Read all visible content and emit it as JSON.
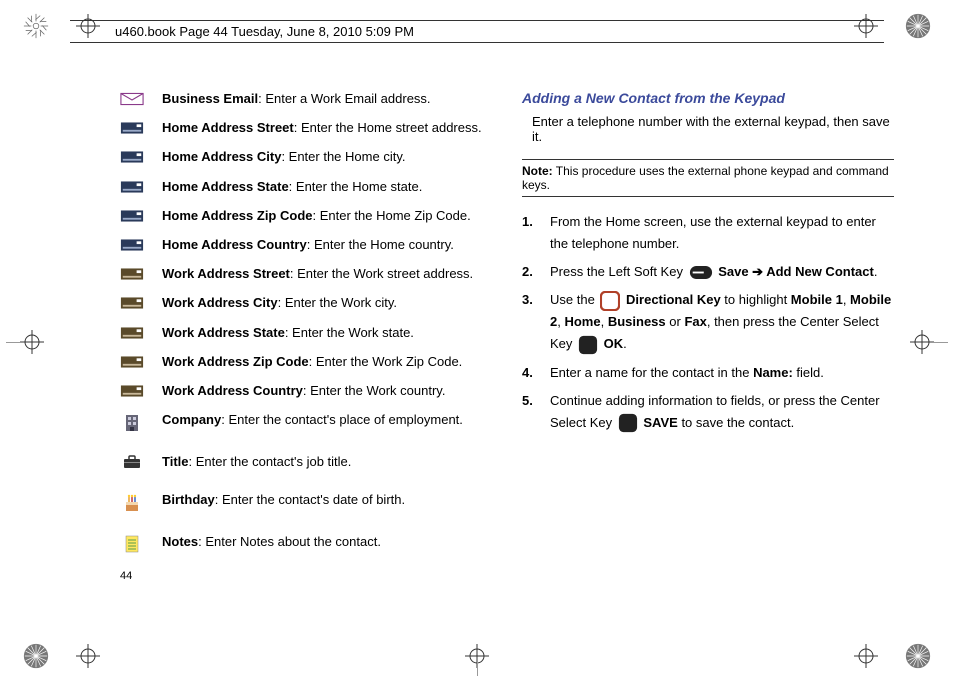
{
  "header": "u460.book  Page 44  Tuesday, June 8, 2010  5:09 PM",
  "page_number": "44",
  "fields": [
    {
      "label": "Business Email",
      "desc": ": Enter a Work Email address.",
      "icon": "envelope"
    },
    {
      "label": "Home Address Street",
      "desc": ": Enter the Home street address.",
      "icon": "card"
    },
    {
      "label": "Home Address City",
      "desc": ": Enter the Home city.",
      "icon": "card"
    },
    {
      "label": "Home Address State",
      "desc": ": Enter the Home state.",
      "icon": "card"
    },
    {
      "label": "Home Address Zip Code",
      "desc": ": Enter the Home Zip Code.",
      "icon": "card"
    },
    {
      "label": "Home Address Country",
      "desc": ": Enter the Home country.",
      "icon": "card"
    },
    {
      "label": "Work Address Street",
      "desc": ": Enter the Work street address.",
      "icon": "card-alt"
    },
    {
      "label": "Work Address City",
      "desc": ": Enter the Work city.",
      "icon": "card-alt"
    },
    {
      "label": "Work Address State",
      "desc": ": Enter the Work state.",
      "icon": "card-alt"
    },
    {
      "label": "Work Address Zip Code",
      "desc": ": Enter the Work Zip Code.",
      "icon": "card-alt"
    },
    {
      "label": "Work Address Country",
      "desc": ": Enter the Work country.",
      "icon": "card-alt"
    },
    {
      "label": "Company",
      "desc": ": Enter the contact's place of employment.",
      "icon": "building"
    },
    {
      "label": "Title",
      "desc": ": Enter the contact's job title.",
      "icon": "briefcase"
    },
    {
      "label": "Birthday",
      "desc": ": Enter the contact's date of birth.",
      "icon": "cake"
    },
    {
      "label": "Notes",
      "desc": ": Enter Notes about the contact.",
      "icon": "notes"
    }
  ],
  "right": {
    "heading": "Adding a New Contact from the Keypad",
    "intro": "Enter a telephone number with the external keypad, then save it.",
    "note_label": "Note:",
    "note_text": " This procedure uses the external phone keypad and command keys.",
    "steps": {
      "s1": "From the Home screen, use the external keypad to enter the telephone number.",
      "s2_a": "Press the Left Soft Key ",
      "s2_save": " Save",
      "s2_arrow": " ➔ ",
      "s2_add": "Add New Contact",
      "s3_a": "Use the ",
      "s3_dir": " Directional Key",
      "s3_b": " to highlight ",
      "s3_m1": "Mobile 1",
      "s3_c": ", ",
      "s3_m2": "Mobile 2",
      "s3_d": ", ",
      "s3_home": "Home",
      "s3_e": ", ",
      "s3_bus": "Business",
      "s3_f": " or ",
      "s3_fax": "Fax",
      "s3_g": ", then press the Center Select Key ",
      "s3_ok": " OK",
      "s4_a": "Enter a name for the contact in the ",
      "s4_name": "Name:",
      "s4_b": " field.",
      "s5_a": "Continue adding information to fields, or press the Center Select Key ",
      "s5_save": " SAVE",
      "s5_b": " to save the contact."
    }
  }
}
